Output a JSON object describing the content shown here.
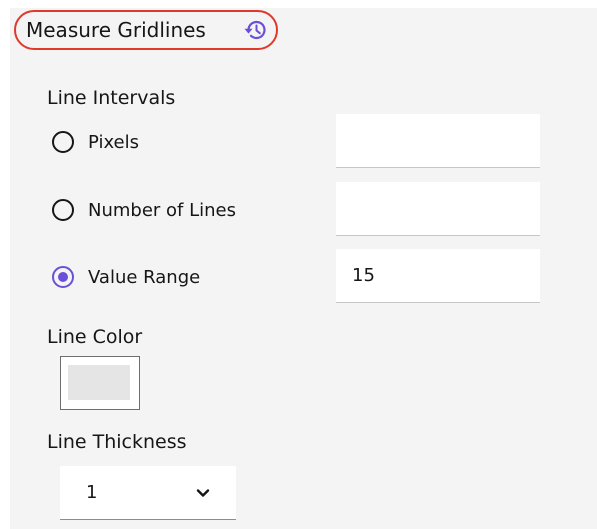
{
  "section": {
    "title": "Measure Gridlines",
    "reset_icon": "history-reset-icon"
  },
  "line_intervals": {
    "label": "Line Intervals",
    "options": [
      {
        "label": "Pixels",
        "checked": false,
        "value": ""
      },
      {
        "label": "Number of Lines",
        "checked": false,
        "value": ""
      },
      {
        "label": "Value Range",
        "checked": true,
        "value": "15"
      }
    ]
  },
  "line_color": {
    "label": "Line Color",
    "swatch_color": "#e5e5e5"
  },
  "line_thickness": {
    "label": "Line Thickness",
    "selected": "1",
    "icon": "chevron-down-icon"
  },
  "colors": {
    "accent": "#6b4fd8",
    "highlight": "#e0382b",
    "panel": "#f4f4f4"
  }
}
